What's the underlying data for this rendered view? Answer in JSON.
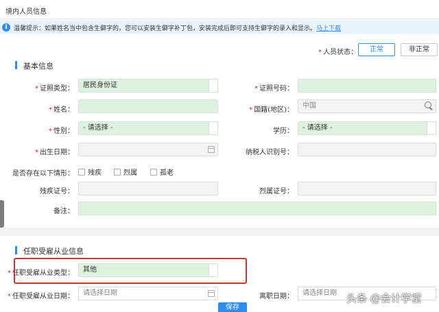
{
  "window": {
    "title": "境内人员信息"
  },
  "notice": {
    "text": "温馨提示：如果姓名当中包含生僻字的，您可以安装生僻字补丁包，安装完成后即可支持生僻字的录入和显示。",
    "link": "马上下载"
  },
  "status": {
    "label": "人员状态：",
    "options": [
      "正常",
      "非正常"
    ],
    "selected": "正常"
  },
  "basic": {
    "title": "基本信息",
    "id_type": {
      "label": "证照类型：",
      "value": "居民身份证"
    },
    "id_number": {
      "label": "证照号码：",
      "value": ""
    },
    "name": {
      "label": "姓名：",
      "value": ""
    },
    "nationality": {
      "label": "国籍(地区)：",
      "placeholder": "中国"
    },
    "gender": {
      "label": "性别：",
      "value": "- 请选择 -"
    },
    "education": {
      "label": "学历：",
      "value": "- 请选择 -"
    },
    "birth_date": {
      "label": "出生日期：",
      "value": ""
    },
    "taxpayer_id": {
      "label": "纳税人识别号：",
      "value": ""
    },
    "situations": {
      "label": "是否存在以下情形：",
      "options": [
        "残疾",
        "烈属",
        "孤老"
      ]
    },
    "disability_cert": {
      "label": "残疾证号：",
      "value": ""
    },
    "martyr_cert": {
      "label": "烈属证号：",
      "value": ""
    },
    "remark": {
      "label": "备注：",
      "value": ""
    }
  },
  "employment": {
    "title": "任职受雇从业信息",
    "type": {
      "label": "任职受雇从业类型：",
      "value": "其他"
    },
    "start_date": {
      "label": "任职受雇从业日期：",
      "placeholder": "请选择日期"
    },
    "leave_date": {
      "label": "离职日期：",
      "placeholder": "请选择日期"
    }
  },
  "actions": {
    "save": "保存"
  },
  "watermark": "头条 @会计学堂",
  "colors": {
    "accent": "#2d8cf0",
    "required": "#e02020",
    "highlight": "#c0392b",
    "field_green": "#dff1df"
  }
}
